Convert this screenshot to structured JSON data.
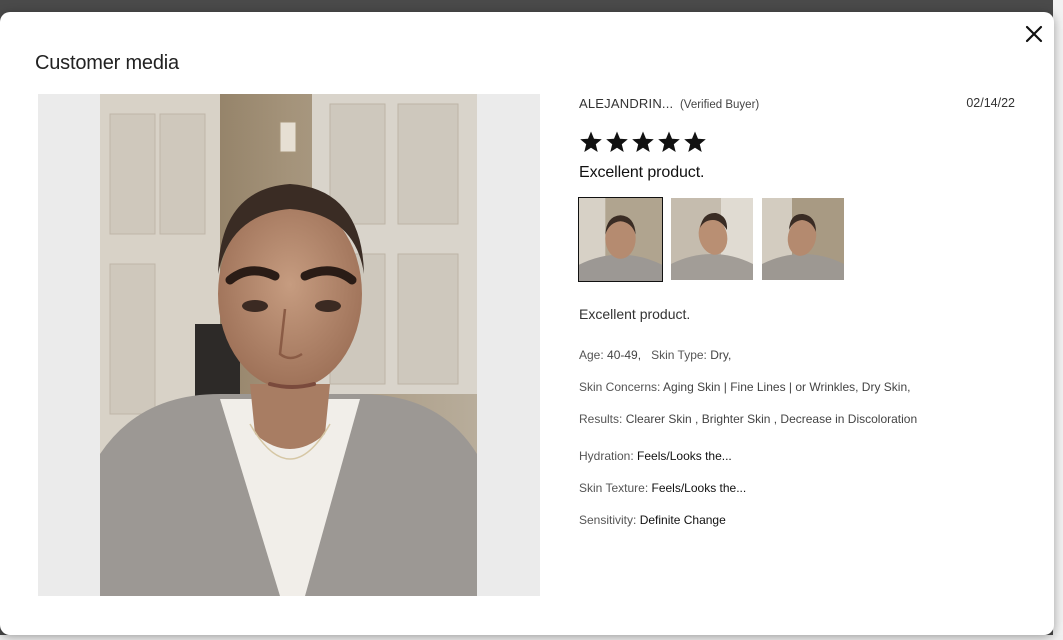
{
  "modal": {
    "title": "Customer media",
    "close_icon": "close-icon"
  },
  "viewer": {
    "next_icon": "chevron-right-icon"
  },
  "review": {
    "reviewer": "ALEJANDRIN...",
    "verified": "(Verified Buyer)",
    "date": "02/14/22",
    "rating": 5,
    "rating_max": 5,
    "headline": "Excellent product.",
    "body": "Excellent product.",
    "age_label": "Age:",
    "age_value": "40-49,",
    "skin_type_label": "Skin Type:",
    "skin_type_value": "Dry,",
    "concerns_label": "Skin Concerns:",
    "concerns_value": "Aging Skin | Fine Lines | or Wrinkles, Dry Skin,",
    "results_label": "Results:",
    "results_value": "Clearer Skin , Brighter Skin , Decrease in Discoloration",
    "hydration_label": "Hydration:",
    "hydration_value": "Feels/Looks the...",
    "texture_label": "Skin Texture:",
    "texture_value": "Feels/Looks the...",
    "sensitivity_label": "Sensitivity:",
    "sensitivity_value": "Definite Change"
  },
  "colors": {
    "overlay": "#4a4a4a",
    "viewer_bg": "#ebebeb",
    "next_button": "#5b5b5b",
    "star": "#111111"
  }
}
